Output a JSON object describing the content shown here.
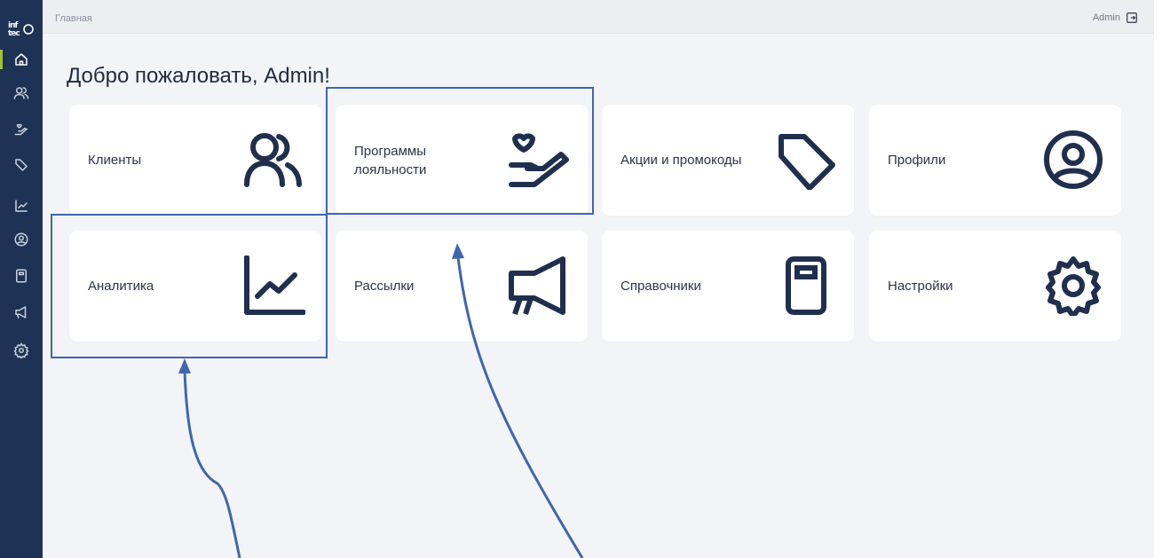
{
  "sidebar": {
    "logo_text": "infotec",
    "items": [
      {
        "name": "home",
        "icon": "home-icon",
        "active": true
      },
      {
        "name": "clients",
        "icon": "users-icon"
      },
      {
        "name": "loyalty",
        "icon": "hand-heart-icon"
      },
      {
        "name": "promos",
        "icon": "tag-icon"
      },
      {
        "name": "analytics",
        "icon": "chart-icon"
      },
      {
        "name": "profiles",
        "icon": "user-circle-icon"
      },
      {
        "name": "directories",
        "icon": "book-icon"
      },
      {
        "name": "mailings",
        "icon": "megaphone-icon"
      },
      {
        "name": "settings",
        "icon": "gear-icon"
      }
    ]
  },
  "header": {
    "breadcrumb": "Главная",
    "user": "Admin"
  },
  "main": {
    "title": "Добро пожаловать, Admin!",
    "cards": [
      {
        "label": "Клиенты",
        "icon": "users-icon"
      },
      {
        "label": "Программы лояльности",
        "icon": "hand-heart-icon"
      },
      {
        "label": "Акции и промокоды",
        "icon": "tag-icon"
      },
      {
        "label": "Профили",
        "icon": "user-circle-icon"
      },
      {
        "label": "Аналитика",
        "icon": "chart-icon"
      },
      {
        "label": "Рассылки",
        "icon": "megaphone-icon"
      },
      {
        "label": "Справочники",
        "icon": "book-icon"
      },
      {
        "label": "Настройки",
        "icon": "gear-icon"
      }
    ]
  },
  "colors": {
    "sidebar_bg": "#1e3255",
    "accent": "#9fc43a",
    "icon_dark": "#1f2f4d",
    "annotation": "#3f66ae"
  }
}
